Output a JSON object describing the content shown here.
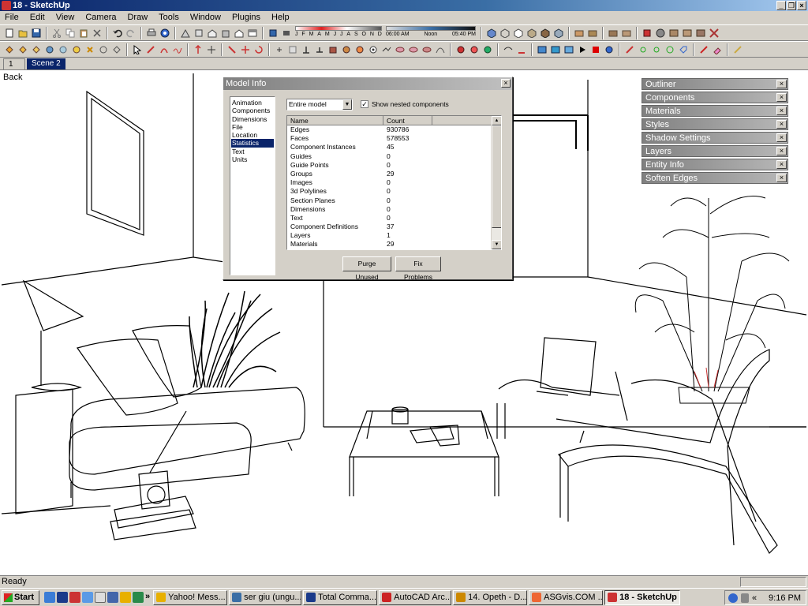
{
  "window": {
    "title": "18 - SketchUp",
    "min": "_",
    "restore": "❐",
    "close": "×"
  },
  "menu": [
    "File",
    "Edit",
    "View",
    "Camera",
    "Draw",
    "Tools",
    "Window",
    "Plugins",
    "Help"
  ],
  "shadow_widget": {
    "months": [
      "J",
      "F",
      "M",
      "A",
      "M",
      "J",
      "J",
      "A",
      "S",
      "O",
      "N",
      "D"
    ],
    "time_start": "06:00 AM",
    "time_mid": "Noon",
    "time_end": "05:40 PM"
  },
  "scenes": {
    "tab1": "1",
    "tab2": "Scene 2"
  },
  "viewport": {
    "view_name": "Back"
  },
  "model_info": {
    "title": "Model Info",
    "categories": [
      "Animation",
      "Components",
      "Dimensions",
      "File",
      "Location",
      "Statistics",
      "Text",
      "Units"
    ],
    "selected_category": "Statistics",
    "scope": "Entire model",
    "show_nested_label": "Show nested components",
    "show_nested_checked": "✓",
    "columns": {
      "name": "Name",
      "count": "Count"
    },
    "rows": [
      {
        "name": "Edges",
        "count": "930786"
      },
      {
        "name": "Faces",
        "count": "578553"
      },
      {
        "name": "Component Instances",
        "count": "45"
      },
      {
        "name": "Guides",
        "count": "0"
      },
      {
        "name": "Guide Points",
        "count": "0"
      },
      {
        "name": "Groups",
        "count": "29"
      },
      {
        "name": "Images",
        "count": "0"
      },
      {
        "name": "3d Polylines",
        "count": "0"
      },
      {
        "name": "Section Planes",
        "count": "0"
      },
      {
        "name": "Dimensions",
        "count": "0"
      },
      {
        "name": "Text",
        "count": "0"
      },
      {
        "name": "Component Definitions",
        "count": "37"
      },
      {
        "name": "Layers",
        "count": "1"
      },
      {
        "name": "Materials",
        "count": "29"
      }
    ],
    "purge_label": "Purge Unused",
    "fix_label": "Fix Problems"
  },
  "tray": [
    "Outliner",
    "Components",
    "Materials",
    "Styles",
    "Shadow Settings",
    "Layers",
    "Entity Info",
    "Soften Edges"
  ],
  "status": {
    "text": "Ready"
  },
  "taskbar": {
    "start": "Start",
    "more": "»",
    "tasks": [
      {
        "label": "Yahoo! Mess...",
        "color": "#e8b000"
      },
      {
        "label": "ser giu (ungu...",
        "color": "#3a6ea5"
      },
      {
        "label": "Total Comma...",
        "color": "#1a3a8a"
      },
      {
        "label": "AutoCAD Arc...",
        "color": "#c22"
      },
      {
        "label": "14. Opeth - D...",
        "color": "#c80"
      },
      {
        "label": "ASGvis.COM ...",
        "color": "#e63"
      },
      {
        "label": "18 - SketchUp",
        "color": "#c33",
        "active": true
      }
    ],
    "chevron": "«",
    "clock": "9:16 PM"
  }
}
